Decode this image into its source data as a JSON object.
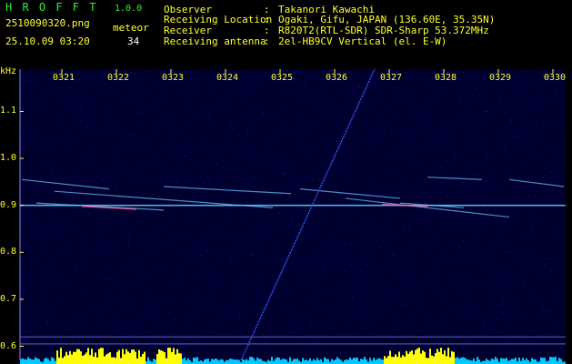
{
  "header": {
    "brand": "H R O F F T",
    "version": "1.0.0",
    "filename": "2510090320.png",
    "datetime": "25.10.09 03:20",
    "meteor_label": "meteor",
    "meteor_count": "34",
    "info": [
      {
        "key": "Observer",
        "value": "Takanori Kawachi"
      },
      {
        "key": "Receiving Location",
        "value": "Ogaki, Gifu, JAPAN (136.60E, 35.35N)"
      },
      {
        "key": "Receiver",
        "value": "R820T2(RTL-SDR) SDR-Sharp 53.372MHz"
      },
      {
        "key": "Receiving antenna",
        "value": "2el-HB9CV Vertical (el. E-W)"
      }
    ]
  },
  "chart_data": {
    "type": "heatmap",
    "ylabel": "kHz",
    "x_ticks": [
      "0321",
      "0322",
      "0323",
      "0324",
      "0325",
      "0326",
      "0327",
      "0328",
      "0329",
      "0330"
    ],
    "y_ticks": [
      "1.1",
      "1.0",
      "0.9",
      "0.8",
      "0.7",
      "0.6"
    ],
    "y_range": [
      0.57,
      1.19
    ],
    "x_range": [
      "03:20",
      "03:30"
    ],
    "carrier_khz": 0.9,
    "colors": {
      "background": "#000030",
      "noise": "#1a1aa8",
      "trace": "#66ccff",
      "peak": "#ff66aa",
      "meteor": "#3355ff",
      "spectrum_high": "#ffff00",
      "spectrum_low": "#00c8ff",
      "labels": "#ffff33",
      "grid": "#8888ff"
    }
  }
}
